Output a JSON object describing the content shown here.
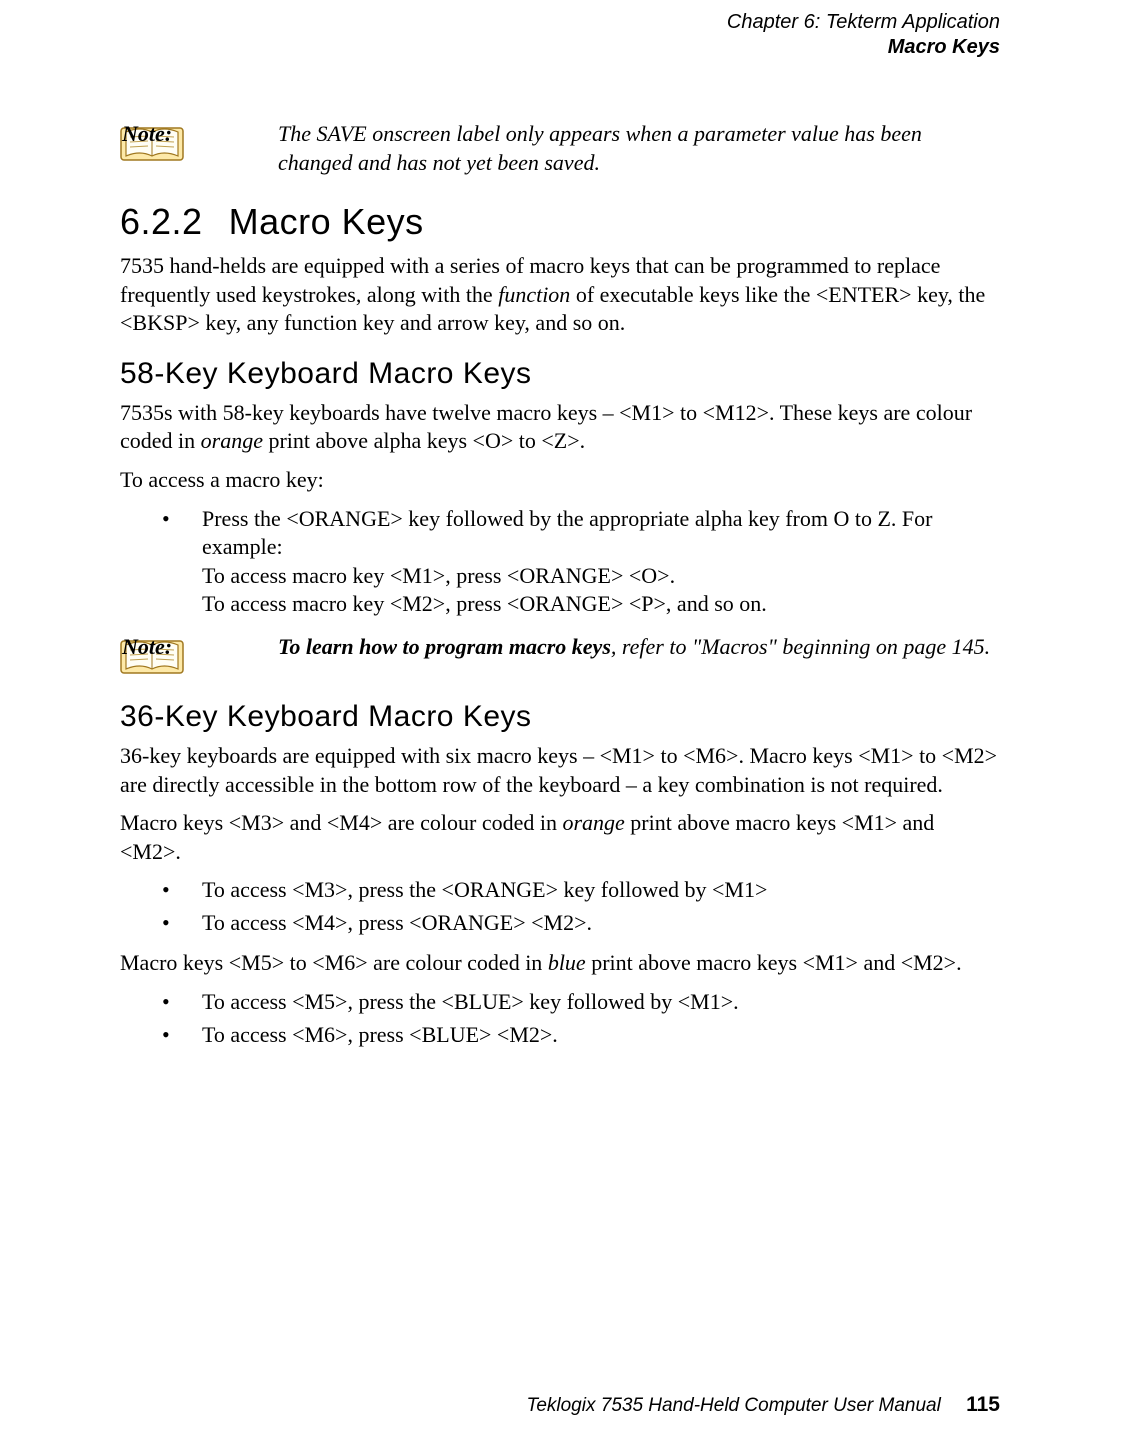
{
  "header": {
    "chapter": "Chapter 6: Tekterm Application",
    "section": "Macro Keys"
  },
  "note1": {
    "label": "Note:",
    "text": "The SAVE onscreen label only appears when a parameter value has been changed and has not yet been saved."
  },
  "section": {
    "number": "6.2.2",
    "title": "Macro Keys"
  },
  "p1_a": "7535 hand-helds are equipped with a series of macro keys that can be programmed to replace frequently used keystrokes, along with the ",
  "p1_i": "function",
  "p1_b": " of executable keys like the <ENTER> key, the <BKSP> key, any function key and arrow key, and so on.",
  "sub1": "58-Key Keyboard Macro Keys",
  "p2_a": "7535s with 58-key keyboards have twelve macro keys – <M1> to <M12>. These keys are colour coded in ",
  "p2_i": "orange",
  "p2_b": " print above alpha keys <O> to <Z>.",
  "p3": "To access a macro key:",
  "list1": {
    "item1_l1": "Press the <ORANGE> key followed by the appropriate alpha key from O to Z. For example:",
    "item1_l2": "To access macro key <M1>, press <ORANGE> <O>.",
    "item1_l3": "To access macro key <M2>, press <ORANGE> <P>, and so on."
  },
  "note2": {
    "label": "Note:",
    "bold": "To learn how to program macro keys",
    "rest": ", refer to \"Macros\" beginning on page 145."
  },
  "sub2": "36-Key Keyboard Macro Keys",
  "p4": "36-key keyboards are equipped with six macro keys – <M1> to <M6>. Macro keys <M1> to <M2> are directly accessible in the bottom row of the keyboard – a key combination is not required.",
  "p5_a": "Macro keys <M3> and <M4> are colour coded in ",
  "p5_i": "orange",
  "p5_b": " print above macro keys <M1> and <M2>.",
  "list2": {
    "item1": "To access <M3>, press the <ORANGE> key followed by <M1>",
    "item2": "To access <M4>, press <ORANGE> <M2>."
  },
  "p6_a": "Macro keys <M5> to <M6> are colour coded in ",
  "p6_i": "blue",
  "p6_b": " print above macro keys <M1> and <M2>.",
  "list3": {
    "item1": "To access <M5>, press the <BLUE> key followed by <M1>.",
    "item2": "To access <M6>, press <BLUE> <M2>."
  },
  "footer": {
    "text": "Teklogix 7535 Hand-Held Computer User Manual",
    "page": "115"
  }
}
